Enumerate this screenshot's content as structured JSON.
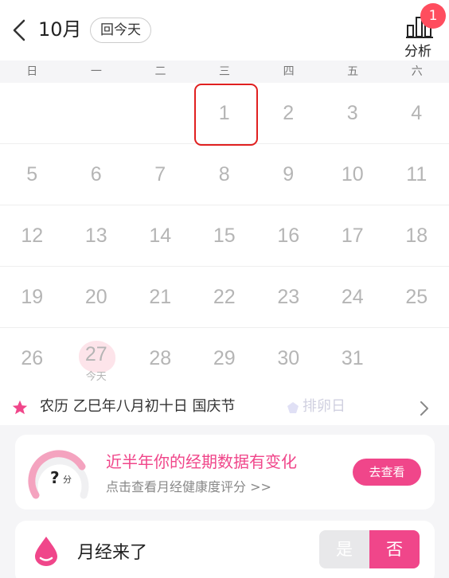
{
  "header": {
    "month": "10月",
    "today_button": "回今天",
    "analysis_label": "分析",
    "analysis_badge": "1"
  },
  "weekdays": [
    "日",
    "一",
    "二",
    "三",
    "四",
    "五",
    "六"
  ],
  "calendar": {
    "weeks": [
      [
        "",
        "",
        "",
        "1",
        "2",
        "3",
        "4"
      ],
      [
        "5",
        "6",
        "7",
        "8",
        "9",
        "10",
        "11"
      ],
      [
        "12",
        "13",
        "14",
        "15",
        "16",
        "17",
        "18"
      ],
      [
        "19",
        "20",
        "21",
        "22",
        "23",
        "24",
        "25"
      ],
      [
        "26",
        "27",
        "28",
        "29",
        "30",
        "31",
        ""
      ]
    ],
    "selected_day": "1",
    "today_day": "27",
    "today_label": "今天"
  },
  "info": {
    "lunar_text": "农历 乙巳年八月初十日 国庆节",
    "ghost_legend_1": "",
    "ghost_legend_2": "排卵日"
  },
  "health_card": {
    "score": "?",
    "score_unit": "分",
    "title": "近半年你的经期数据有变化",
    "subtitle": "点击查看月经健康度评分 >>",
    "button": "去查看"
  },
  "period_card": {
    "label": "月经来了",
    "yes": "是",
    "no": "否"
  },
  "colors": {
    "accent": "#f0468a",
    "selected_border": "#e02020",
    "badge": "#ff4d5e"
  }
}
